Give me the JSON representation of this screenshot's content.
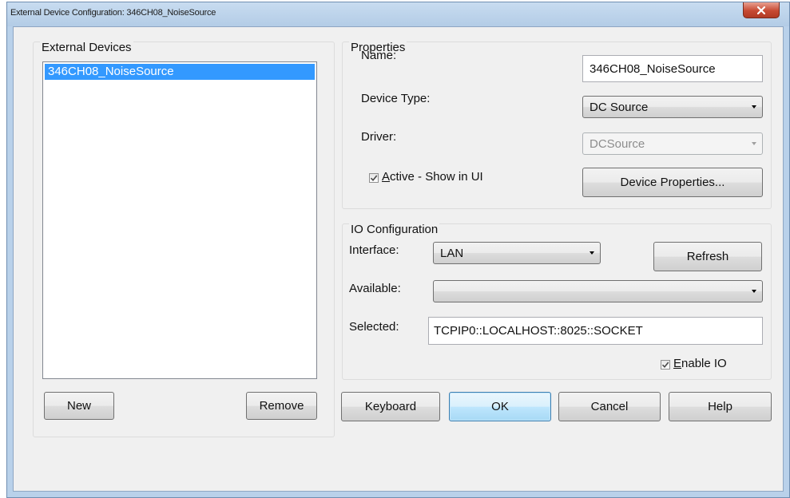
{
  "window": {
    "title": "External Device Configuration: 346CH08_NoiseSource",
    "close_label": "x"
  },
  "devices_group": {
    "title": "External Devices",
    "items": [
      {
        "label": "346CH08_NoiseSource",
        "selected": true
      }
    ],
    "new_label": "New",
    "remove_label": "Remove"
  },
  "properties": {
    "title": "Properties",
    "name_label": "Name:",
    "name_value": "346CH08_NoiseSource",
    "device_type_label": "Device Type:",
    "device_type_value": "DC Source",
    "driver_label": "Driver:",
    "driver_value": "DCSource",
    "active_first": "A",
    "active_rest": "ctive - Show in UI",
    "active_checked": true,
    "device_properties_label": "Device Properties..."
  },
  "io": {
    "title": "IO Configuration",
    "interface_label": "Interface:",
    "interface_value": "LAN",
    "refresh_label": "Refresh",
    "available_label": "Available:",
    "available_value": "",
    "selected_label": "Selected:",
    "selected_value": "TCPIP0::LOCALHOST::8025::SOCKET",
    "enable_first": "E",
    "enable_rest": "nable IO",
    "enable_checked": true
  },
  "footer": {
    "keyboard_label": "Keyboard",
    "ok_label": "OK",
    "cancel_label": "Cancel",
    "help_label": "Help"
  },
  "colors": {
    "selection": "#3399ff",
    "window_frame": "#b9d1ea",
    "close_button": "#c74a33",
    "dialog_background": "#f0f0f0"
  },
  "icons": [
    "close-icon",
    "chevron-down-icon",
    "checkmark-icon"
  ]
}
